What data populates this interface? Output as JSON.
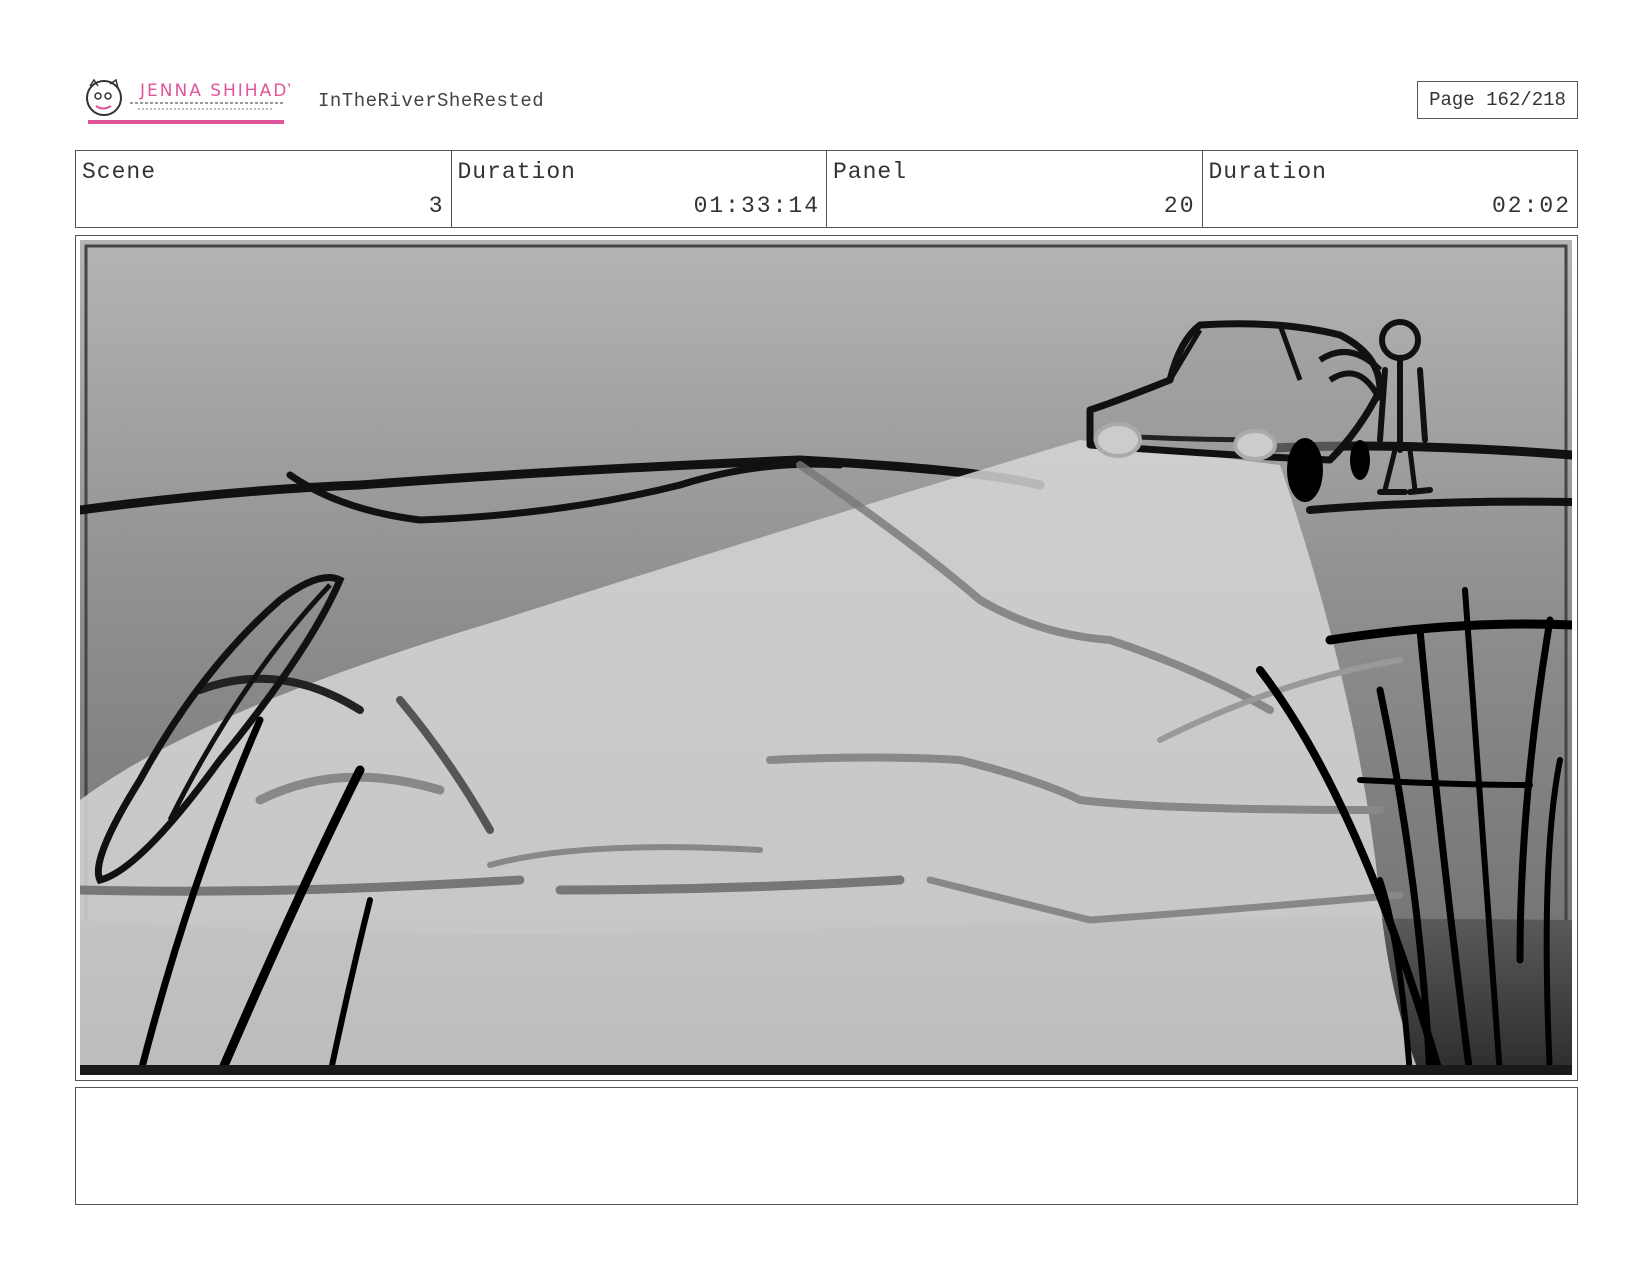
{
  "header": {
    "logo_text": "JENNA SHIHADY",
    "project_title": "InTheRiverSheRested",
    "page_label": "Page 162/218"
  },
  "info": {
    "scene_label": "Scene",
    "scene_value": "3",
    "scene_duration_label": "Duration",
    "scene_duration_value": "01:33:14",
    "panel_label": "Panel",
    "panel_value": "20",
    "panel_duration_label": "Duration",
    "panel_duration_value": "02:02"
  },
  "notes": {
    "text": ""
  },
  "colors": {
    "logo_pink": "#e0559a",
    "border": "#555555"
  }
}
